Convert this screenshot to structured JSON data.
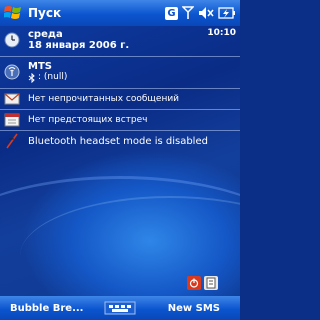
{
  "titlebar": {
    "title": "Пуск",
    "time": "10:10",
    "tray_badge": "G"
  },
  "date": {
    "weekday": "среда",
    "full_date": "18 января 2006 г."
  },
  "owner": {
    "name": "MTS",
    "bluetooth_status": ": (null)"
  },
  "messages": {
    "text": "Нет непрочитанных сообщений"
  },
  "calendar": {
    "text": "Нет предстоящих встреч"
  },
  "bluetooth": {
    "text": "Bluetooth headset mode is disabled"
  },
  "softkeys": {
    "left": "Bubble Bre...",
    "right": "New SMS"
  },
  "colors": {
    "titlebar": "#0b55cf",
    "desktop": "#0a2c86",
    "separator": "#b4c8f0",
    "alert": "#d93a1e"
  }
}
